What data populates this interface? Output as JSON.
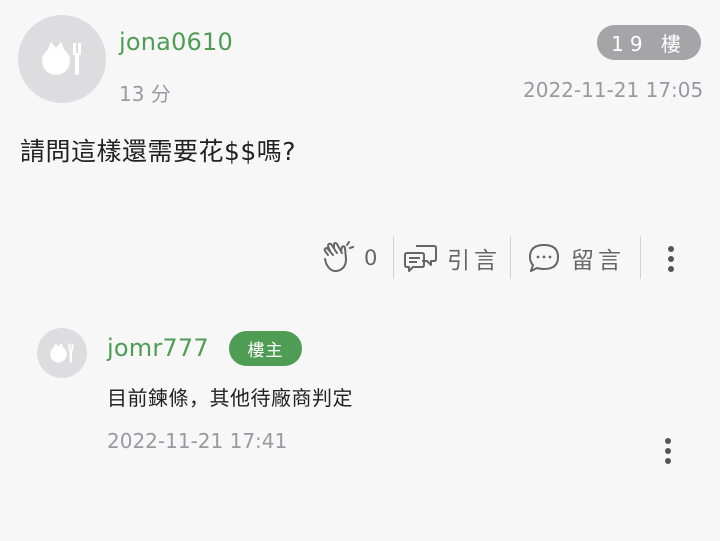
{
  "post": {
    "author": "jona0610",
    "relative_time": "13 分",
    "floor": "19 樓",
    "datetime": "2022-11-21 17:05",
    "content": "請問這樣還需要花$$嗎?",
    "actions": {
      "like_count": "0",
      "quote_label": "引言",
      "comment_label": "留言"
    }
  },
  "reply": {
    "author": "jomr777",
    "badge": "樓主",
    "content": "目前鍊條，其他待廠商判定",
    "datetime": "2022-11-21 17:41"
  },
  "colors": {
    "accent_green": "#4f9d55",
    "badge_gray": "#a5a5a8",
    "background": "#f7f7f8"
  },
  "icons": [
    "default-avatar-icon",
    "clap-icon",
    "quote-bubble-icon",
    "comment-bubble-icon",
    "more-vertical-icon"
  ]
}
